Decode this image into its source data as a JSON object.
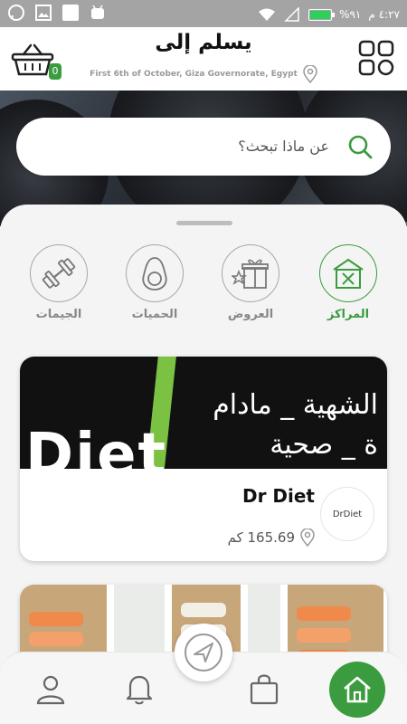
{
  "status_bar": {
    "time": "٤:٢٧ م",
    "battery": "%٩١",
    "battery_level": 0.91,
    "icons": [
      "whatsapp-icon",
      "gallery-icon",
      "blank-icon",
      "android-icon",
      "wifi-icon",
      "signal-icon"
    ]
  },
  "header": {
    "title": "يسلم إلى",
    "address": "First 6th of October, Giza Governorate, Egypt",
    "cart_count": "0"
  },
  "search": {
    "placeholder": "عن ماذا تبحث؟"
  },
  "categories": [
    {
      "label": "المراكز",
      "icon": "restaurant-icon",
      "active": true
    },
    {
      "label": "العروض",
      "icon": "gift-icon",
      "active": false
    },
    {
      "label": "الحميات",
      "icon": "avocado-icon",
      "active": false
    },
    {
      "label": "الجيمات",
      "icon": "dumbbell-icon",
      "active": false
    }
  ],
  "cards": [
    {
      "name": "Dr Diet",
      "distance": "165.69 كم",
      "banner_line1": "الشهية _ مادام",
      "banner_line2": "ة _ صحية",
      "banner_big": "Diet",
      "logo_text": "DrDiet"
    }
  ],
  "nav": {
    "items": [
      "profile-icon",
      "bell-icon",
      "shopping-bag-icon",
      "home-icon"
    ]
  },
  "colors": {
    "accent": "#3a9c3e",
    "status_bar": "#a4a4a4"
  }
}
